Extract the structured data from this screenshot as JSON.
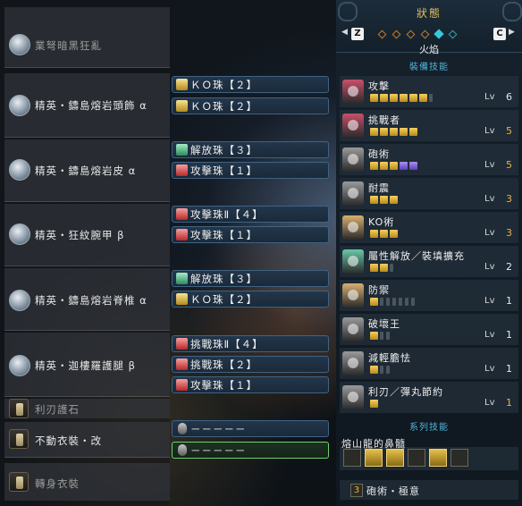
{
  "status_panel": {
    "title": "狀態",
    "key_left": "Z",
    "key_right": "C",
    "weapon_element": "火焰",
    "equip_skills_header": "裝備技能",
    "series_skills_header": "系列技能",
    "skills": [
      {
        "name": "攻擊",
        "lv_label": "Lv",
        "level": "6",
        "max": false,
        "pips_on": 6,
        "pips_decor": 0,
        "pips_off": 1,
        "icon": "attack-skill-icon",
        "color": "#c8506a"
      },
      {
        "name": "挑戰者",
        "lv_label": "Lv",
        "level": "5",
        "max": true,
        "pips_on": 5,
        "pips_decor": 0,
        "pips_off": 0,
        "icon": "challenger-skill-icon",
        "color": "#c8506a"
      },
      {
        "name": "砲術",
        "lv_label": "Lv",
        "level": "5",
        "max": true,
        "pips_on": 3,
        "pips_decor": 2,
        "pips_off": 0,
        "icon": "artillery-skill-icon",
        "color": "#9a9a9a"
      },
      {
        "name": "耐震",
        "lv_label": "Lv",
        "level": "3",
        "max": true,
        "pips_on": 3,
        "pips_decor": 0,
        "pips_off": 0,
        "icon": "tremor-resistance-skill-icon",
        "color": "#9a9a9a"
      },
      {
        "name": "KO術",
        "lv_label": "Lv",
        "level": "3",
        "max": true,
        "pips_on": 3,
        "pips_decor": 0,
        "pips_off": 0,
        "icon": "slugger-skill-icon",
        "color": "#d8b070"
      },
      {
        "name": "屬性解放／裝填擴充",
        "lv_label": "Lv",
        "level": "2",
        "max": false,
        "pips_on": 2,
        "pips_decor": 0,
        "pips_off": 1,
        "icon": "free-elem-ammo-up-skill-icon",
        "color": "#6ac8a8"
      },
      {
        "name": "防禦",
        "lv_label": "Lv",
        "level": "1",
        "max": false,
        "pips_on": 1,
        "pips_decor": 0,
        "pips_off": 6,
        "icon": "guard-skill-icon",
        "color": "#d8b070"
      },
      {
        "name": "破壞王",
        "lv_label": "Lv",
        "level": "1",
        "max": false,
        "pips_on": 1,
        "pips_decor": 0,
        "pips_off": 2,
        "icon": "partbreaker-skill-icon",
        "color": "#9a9a9a"
      },
      {
        "name": "減輕膽怯",
        "lv_label": "Lv",
        "level": "1",
        "max": false,
        "pips_on": 1,
        "pips_decor": 0,
        "pips_off": 2,
        "icon": "flinch-free-skill-icon",
        "color": "#9a9a9a"
      },
      {
        "name": "利刃／彈丸節約",
        "lv_label": "Lv",
        "level": "1",
        "max": true,
        "pips_on": 1,
        "pips_decor": 0,
        "pips_off": 0,
        "icon": "speed-sharpening-skill-icon",
        "color": "#9a9a9a"
      }
    ],
    "set_skill_name": "熔山龍的鼻髓",
    "set_pieces_on": [
      false,
      true,
      true,
      false,
      true,
      false
    ],
    "set_bonus_count": "3",
    "set_bonus_name": "砲術・極意"
  },
  "equipment": [
    {
      "name": "業弩暗黑狂亂",
      "dim": true,
      "icon": "weapon-icon",
      "jewels": []
    },
    {
      "name": "精英・鑄島熔岩頭飾 α",
      "dim": false,
      "icon": "helm-icon",
      "jewels": [
        {
          "color": "yel",
          "text": "ＫＯ珠【２】"
        },
        {
          "color": "yel",
          "text": "ＫＯ珠【２】"
        }
      ]
    },
    {
      "name": "精英・鑄島熔岩皮 α",
      "dim": false,
      "icon": "chest-icon",
      "jewels": [
        {
          "color": "grn",
          "text": "解放珠【３】"
        },
        {
          "color": "red",
          "text": "攻擊珠【１】"
        }
      ]
    },
    {
      "name": "精英・狂紋腕甲 β",
      "dim": false,
      "icon": "arms-icon",
      "jewels": [
        {
          "color": "red",
          "text": "攻擊珠Ⅱ【４】"
        },
        {
          "color": "red",
          "text": "攻擊珠【１】"
        }
      ]
    },
    {
      "name": "精英・鑄島熔岩脊椎 α",
      "dim": false,
      "icon": "waist-icon",
      "jewels": [
        {
          "color": "grn",
          "text": "解放珠【３】"
        },
        {
          "color": "yel",
          "text": "ＫＯ珠【２】"
        }
      ]
    },
    {
      "name": "精英・迦樓羅護腿 β",
      "dim": false,
      "icon": "legs-icon",
      "jewels": [
        {
          "color": "red",
          "text": "挑戰珠Ⅱ【４】"
        },
        {
          "color": "red",
          "text": "挑戰珠【２】"
        },
        {
          "color": "red",
          "text": "攻擊珠【１】"
        }
      ]
    },
    {
      "name": "利刃護石",
      "dim": true,
      "icon": "charm-icon",
      "jewels": []
    },
    {
      "name": "不動衣裝・改",
      "dim": false,
      "icon": "mantle-icon",
      "jewels": [
        {
          "color": "gry",
          "text": "－－－－－"
        },
        {
          "color": "gry",
          "text": "－－－－－",
          "selected": true
        }
      ]
    },
    {
      "name": "轉身衣裝",
      "dim": true,
      "icon": "mantle-icon-2",
      "jewels": []
    }
  ]
}
